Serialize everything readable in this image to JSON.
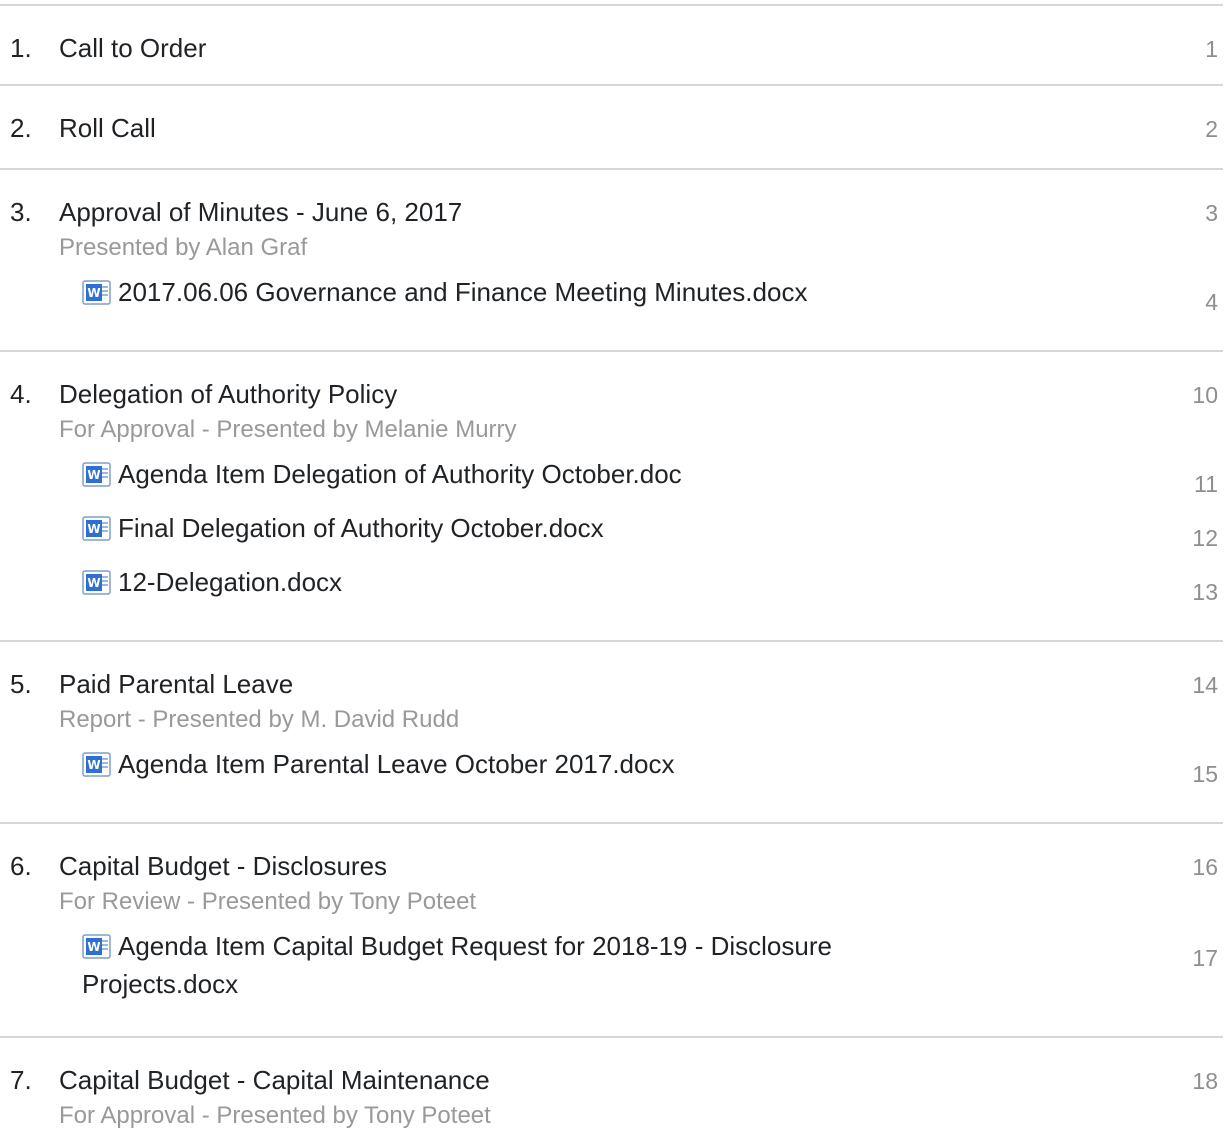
{
  "items": [
    {
      "number": "1.",
      "title": "Call to Order",
      "page": "1"
    },
    {
      "number": "2.",
      "title": "Roll Call",
      "page": "2"
    },
    {
      "number": "3.",
      "title": "Approval of Minutes - June 6, 2017",
      "page": "3",
      "subtitle": "Presented by Alan Graf",
      "attachments": [
        {
          "name": "2017.06.06 Governance and Finance Meeting Minutes.docx",
          "page": "4"
        }
      ]
    },
    {
      "number": "4.",
      "title": "Delegation of Authority Policy",
      "page": "10",
      "subtitle": "For Approval - Presented by Melanie Murry",
      "attachments": [
        {
          "name": "Agenda Item Delegation of Authority October.doc",
          "page": "11"
        },
        {
          "name": "Final Delegation of Authority October.docx",
          "page": "12"
        },
        {
          "name": "12-Delegation.docx",
          "page": "13"
        }
      ]
    },
    {
      "number": "5.",
      "title": "Paid Parental Leave",
      "page": "14",
      "subtitle": "Report - Presented by M. David Rudd",
      "attachments": [
        {
          "name": "Agenda Item Parental Leave October 2017.docx",
          "page": "15"
        }
      ]
    },
    {
      "number": "6.",
      "title": "Capital Budget - Disclosures",
      "page": "16",
      "subtitle": "For Review - Presented by Tony Poteet",
      "attachments": [
        {
          "name_line1": "Agenda Item Capital Budget Request for 2018-19 - Disclosure",
          "name_line2": "Projects.docx",
          "page": "17"
        }
      ]
    },
    {
      "number": "7.",
      "title": "Capital Budget - Capital Maintenance",
      "page": "18",
      "subtitle": "For Approval - Presented by Tony Poteet"
    }
  ],
  "icons": {
    "attachment": "word-document-icon"
  },
  "colors": {
    "divider": "#d6d6d6",
    "subtitle": "#999999",
    "page_number": "#8e8e8e",
    "icon_blue": "#2f6fcf"
  }
}
